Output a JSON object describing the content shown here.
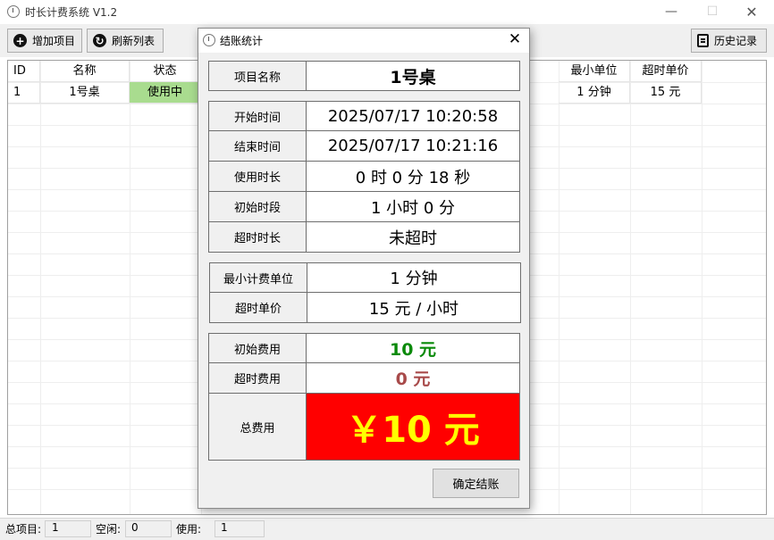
{
  "window": {
    "title": "时长计费系统 V1.2",
    "min": "—",
    "max": "☐",
    "close": "✕"
  },
  "toolbar": {
    "add_label": "增加项目",
    "refresh_label": "刷新列表",
    "history_label": "历史记录"
  },
  "grid": {
    "headers": {
      "id": "ID",
      "name": "名称",
      "status": "状态",
      "min_unit": "最小单位",
      "overtime_price": "超时单价"
    },
    "rows": [
      {
        "id": "1",
        "name": "1号桌",
        "status": "使用中",
        "min_unit": "1 分钟",
        "overtime_price": "15 元"
      }
    ],
    "status_color": "#a9dc8f"
  },
  "statusbar": {
    "total_label": "总项目:",
    "total": "1",
    "idle_label": "空闲:",
    "idle": "0",
    "inuse_label": "使用:",
    "inuse": "1"
  },
  "dialog": {
    "title": "结账统计",
    "close": "✕",
    "item_name_label": "项目名称",
    "item_name": "1号桌",
    "start_label": "开始时间",
    "start": "2025/07/17 10:20:58",
    "end_label": "结束时间",
    "end": "2025/07/17 10:21:16",
    "duration_label": "使用时长",
    "duration": "0 时 0 分 18 秒",
    "initial_period_label": "初始时段",
    "initial_period": "1 小时 0 分",
    "overtime_label": "超时时长",
    "overtime": "未超时",
    "min_unit_label": "最小计费单位",
    "min_unit": "1 分钟",
    "overtime_price_label": "超时单价",
    "overtime_price": "15 元 / 小时",
    "initial_fee_label": "初始费用",
    "initial_fee": "10 元",
    "overtime_fee_label": "超时费用",
    "overtime_fee": "0 元",
    "total_fee_label": "总费用",
    "total_fee": "￥10 元",
    "confirm_label": "确定结账",
    "colors": {
      "initial_fee": "#0a8a0a",
      "overtime_fee": "#a84a4a",
      "total_bg": "#ff0000",
      "total_fg": "#ffff00"
    }
  }
}
